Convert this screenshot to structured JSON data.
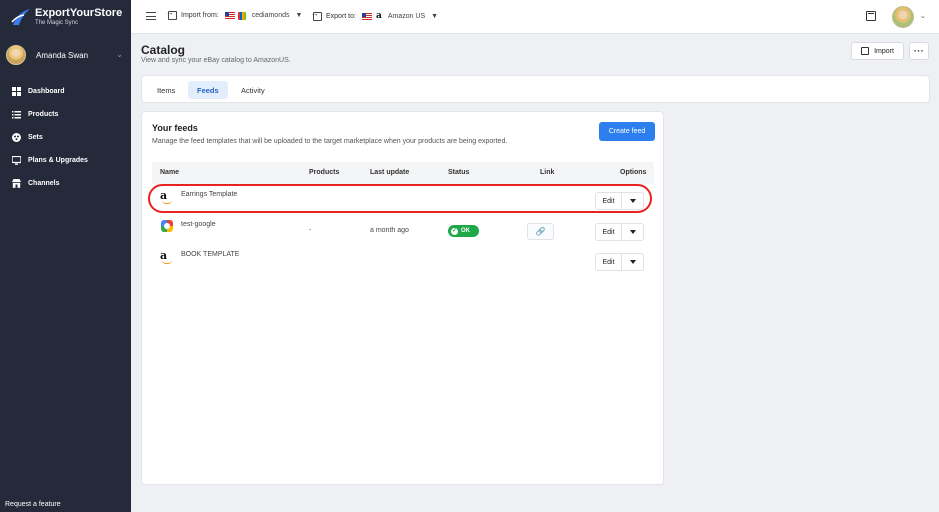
{
  "brand": {
    "title": "ExportYourStore",
    "tagline": "The Magic Sync"
  },
  "user": {
    "name": "Amanda Swan"
  },
  "nav": [
    {
      "label": "Dashboard",
      "icon": "dashboard-icon"
    },
    {
      "label": "Products",
      "icon": "list-icon"
    },
    {
      "label": "Sets",
      "icon": "sets-icon"
    },
    {
      "label": "Plans & Upgrades",
      "icon": "plans-icon"
    },
    {
      "label": "Channels",
      "icon": "channels-icon"
    }
  ],
  "footer": {
    "request_feature": "Request a feature"
  },
  "topbar": {
    "import_label": "Import from:",
    "import_value": "cediamonds",
    "export_label": "Export to:",
    "export_value": "Amazon US"
  },
  "page": {
    "title": "Catalog",
    "subtitle": "View and sync your eBay catalog to AmazonUS.",
    "import_button": "Import"
  },
  "tabs": [
    {
      "label": "Items",
      "active": false
    },
    {
      "label": "Feeds",
      "active": true
    },
    {
      "label": "Activity",
      "active": false
    }
  ],
  "feeds": {
    "title": "Your feeds",
    "subtitle": "Manage the feed templates that will be uploaded to the target marketplace when your products are being exported.",
    "create_button": "Create feed",
    "columns": {
      "name": "Name",
      "products": "Products",
      "last_update": "Last update",
      "status": "Status",
      "link": "Link",
      "options": "Options"
    },
    "rows": [
      {
        "name": "Earrings Template",
        "logo": "amazon-logo-icon",
        "products": "",
        "last_update": "",
        "status": "",
        "edit": "Edit"
      },
      {
        "name": "test-google",
        "logo": "google-logo-icon",
        "products": "-",
        "last_update": "a month ago",
        "status": "OK",
        "edit": "Edit"
      },
      {
        "name": "BOOK TEMPLATE",
        "logo": "amazon-logo-icon",
        "products": "",
        "last_update": "",
        "status": "",
        "edit": "Edit"
      }
    ]
  },
  "colors": {
    "sidebar": "#252a3b",
    "primary": "#2d7ff0",
    "success": "#1fa84a",
    "highlight": "#e8231f"
  }
}
